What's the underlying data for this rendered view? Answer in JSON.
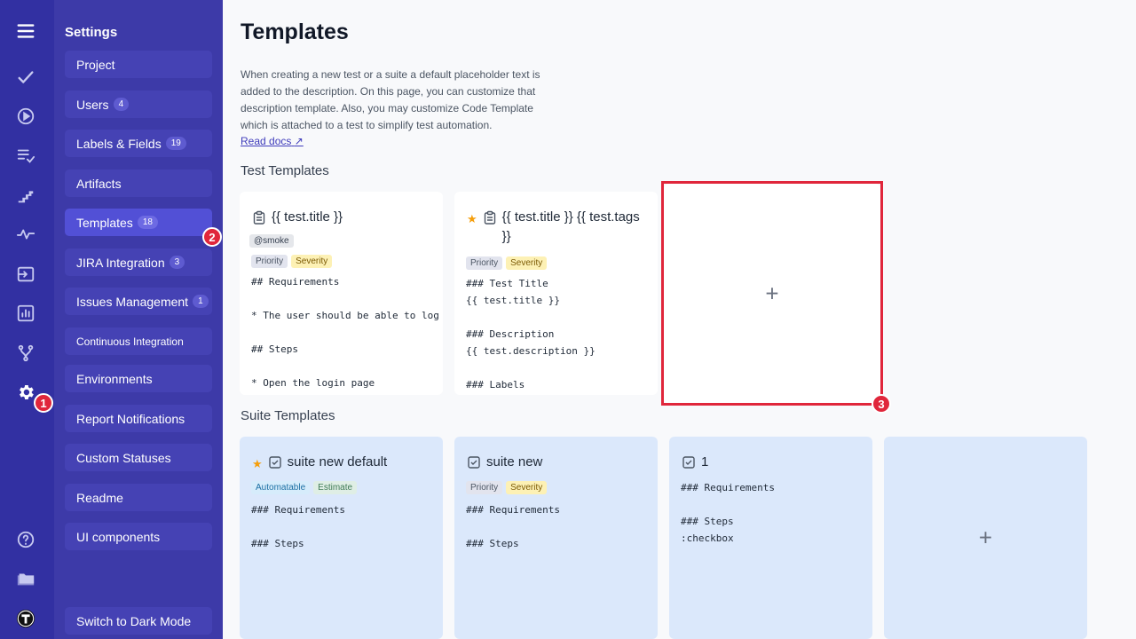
{
  "rail": {
    "icons": [
      "menu-icon",
      "check-icon",
      "play-icon",
      "list-check-icon",
      "stairs-icon",
      "pulse-icon",
      "import-icon",
      "chart-icon",
      "branch-icon",
      "gear-icon",
      "help-icon",
      "folder-icon",
      "avatar-icon"
    ],
    "badges": {
      "settings": "1"
    }
  },
  "settings": {
    "title": "Settings",
    "items": [
      {
        "label": "Project",
        "count": ""
      },
      {
        "label": "Users",
        "count": "4"
      },
      {
        "label": "Labels & Fields",
        "count": "19"
      },
      {
        "label": "Artifacts",
        "count": ""
      },
      {
        "label": "Templates",
        "count": "18"
      },
      {
        "label": "JIRA Integration",
        "count": "3"
      },
      {
        "label": "Issues Management",
        "count": "1"
      },
      {
        "label": "Continuous Integration",
        "count": ""
      },
      {
        "label": "Environments",
        "count": ""
      },
      {
        "label": "Report Notifications",
        "count": ""
      },
      {
        "label": "Custom Statuses",
        "count": ""
      },
      {
        "label": "Readme",
        "count": ""
      },
      {
        "label": "UI components",
        "count": ""
      }
    ],
    "dark_mode": "Switch to Dark Mode",
    "templates_badge": "2"
  },
  "main": {
    "title": "Templates",
    "description": "When creating a new test or a suite a default placeholder text is added to the description. On this page, you can customize that description template. Also, you may customize Code Template which is attached to a test to simplify test automation.",
    "read_docs": "Read docs",
    "test_section": "Test Templates",
    "suite_section": "Suite Templates",
    "test_templates": [
      {
        "title": "{{ test.title }}",
        "tags": [
          "@smoke"
        ],
        "labels": [
          "Priority",
          "Severity"
        ],
        "code": "## Requirements\n\n* The user should be able to log\n\n## Steps\n\n* Open the login page"
      },
      {
        "title": "{{ test.title }} {{ test.tags }}",
        "labels": [
          "Priority",
          "Severity"
        ],
        "code": "### Test Title\n{{ test.title }}\n\n### Description\n{{ test.description }}\n\n### Labels"
      }
    ],
    "suite_templates": [
      {
        "title": "suite new default",
        "labels": [
          "Automatable",
          "Estimate"
        ],
        "code": "### Requirements\n\n### Steps"
      },
      {
        "title": "suite new",
        "labels": [
          "Priority",
          "Severity"
        ],
        "code": "### Requirements\n\n### Steps"
      },
      {
        "title": "1",
        "code": "### Requirements\n\n### Steps\n:checkbox"
      }
    ],
    "add_symbol": "+",
    "add_badge": "3"
  },
  "colors": {
    "rail": "#3230a2",
    "panel": "#3d3aa8",
    "highlight": "#e0263b",
    "suite_card": "#dbe8fb"
  }
}
